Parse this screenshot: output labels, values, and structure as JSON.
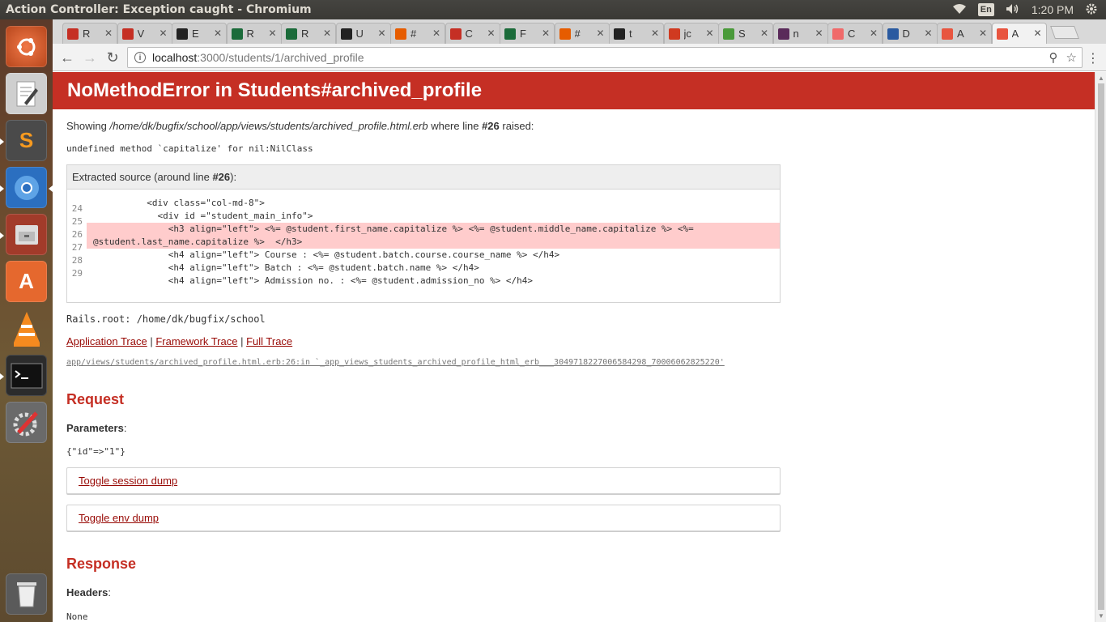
{
  "window_title": "Action Controller: Exception caught - Chromium",
  "panel": {
    "lang": "En",
    "clock": "1:20 PM"
  },
  "tabs": [
    {
      "label": "R",
      "color": "#c52f24"
    },
    {
      "label": "V",
      "color": "#c52f24"
    },
    {
      "label": "E",
      "color": "#222222"
    },
    {
      "label": "R",
      "color": "#1b6b3a"
    },
    {
      "label": "R",
      "color": "#1b6b3a"
    },
    {
      "label": "U",
      "color": "#222222"
    },
    {
      "label": "#",
      "color": "#e65c00"
    },
    {
      "label": "C",
      "color": "#c52f24"
    },
    {
      "label": "F",
      "color": "#1b6b3a"
    },
    {
      "label": "#",
      "color": "#e65c00"
    },
    {
      "label": "t",
      "color": "#222222"
    },
    {
      "label": "jc",
      "color": "#d03a20"
    },
    {
      "label": "S",
      "color": "#4a9a3a"
    },
    {
      "label": "n",
      "color": "#5a2a5a"
    },
    {
      "label": "C",
      "color": "#f06a6a"
    },
    {
      "label": "D",
      "color": "#2a5aa0"
    },
    {
      "label": "A",
      "color": "#e8553f"
    },
    {
      "label": "A",
      "color": "#e8553f"
    }
  ],
  "address": {
    "host": "localhost",
    "path": ":3000/students/1/archived_profile"
  },
  "error": {
    "title": "NoMethodError in Students#archived_profile",
    "showing_prefix": "Showing ",
    "file": "/home/dk/bugfix/school/app/views/students/archived_profile.html.erb",
    "where": " where line ",
    "line": "#26",
    "raised": " raised:",
    "message": "undefined method `capitalize' for nil:NilClass",
    "extracted_prefix": "Extracted source (around line ",
    "extracted_line": "#26",
    "extracted_suffix": "):",
    "line_numbers": [
      "24",
      "25",
      "26",
      "27",
      "28",
      "29"
    ],
    "code": [
      "          <div class=\"col-md-8\">",
      "            <div id =\"student_main_info\">",
      "              <h3 align=\"left\"> <%= @student.first_name.capitalize %> <%= @student.middle_name.capitalize %> <%=",
      "@student.last_name.capitalize %>  </h3>",
      "              <h4 align=\"left\"> Course : <%= @student.batch.course.course_name %> </h4>",
      "              <h4 align=\"left\"> Batch : <%= @student.batch.name %> </h4>",
      "              <h4 align=\"left\"> Admission no. : <%= @student.admission_no %> </h4>"
    ],
    "rails_root": "Rails.root: /home/dk/bugfix/school",
    "trace_links": [
      "Application Trace",
      "Framework Trace",
      "Full Trace"
    ],
    "trace_sep": " | ",
    "trace_line": "app/views/students/archived_profile.html.erb:26:in `_app_views_students_archived_profile_html_erb___3049718227006584298_70006062825220'"
  },
  "request": {
    "heading": "Request",
    "params_label": "Parameters",
    "params_value": "{\"id\"=>\"1\"}",
    "toggle_session": "Toggle session dump",
    "toggle_env": "Toggle env dump"
  },
  "response": {
    "heading": "Response",
    "headers_label": "Headers",
    "headers_value": "None"
  }
}
